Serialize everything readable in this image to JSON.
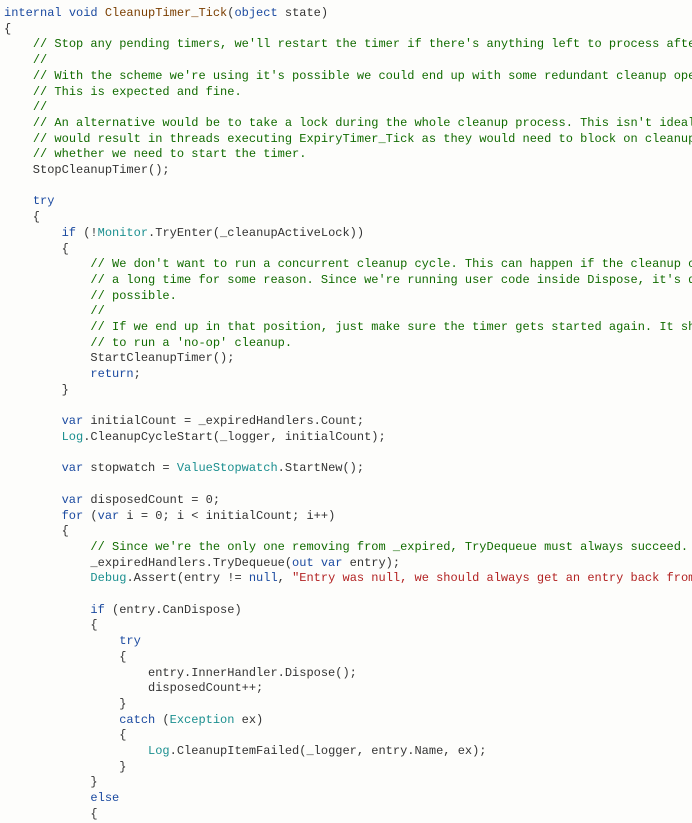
{
  "tokens": [
    {
      "c": "kw",
      "t": "internal"
    },
    {
      "t": " "
    },
    {
      "c": "kw",
      "t": "void"
    },
    {
      "t": " "
    },
    {
      "c": "method",
      "t": "CleanupTimer_Tick"
    },
    {
      "t": "("
    },
    {
      "c": "kw",
      "t": "object"
    },
    {
      "t": " state)\n"
    },
    {
      "t": "{\n"
    },
    {
      "t": "    "
    },
    {
      "c": "cmt",
      "t": "// Stop any pending timers, we'll restart the timer if there's anything left to process after cleanup"
    },
    {
      "t": "\n"
    },
    {
      "t": "    "
    },
    {
      "c": "cmt",
      "t": "//"
    },
    {
      "t": "\n"
    },
    {
      "t": "    "
    },
    {
      "c": "cmt",
      "t": "// With the scheme we're using it's possible we could end up with some redundant cleanup operations."
    },
    {
      "t": "\n"
    },
    {
      "t": "    "
    },
    {
      "c": "cmt",
      "t": "// This is expected and fine."
    },
    {
      "t": "\n"
    },
    {
      "t": "    "
    },
    {
      "c": "cmt",
      "t": "//"
    },
    {
      "t": "\n"
    },
    {
      "t": "    "
    },
    {
      "c": "cmt",
      "t": "// An alternative would be to take a lock during the whole cleanup process. This isn't ideal because it"
    },
    {
      "t": "\n"
    },
    {
      "t": "    "
    },
    {
      "c": "cmt",
      "t": "// would result in threads executing ExpiryTimer_Tick as they would need to block on cleanup to figure out"
    },
    {
      "t": "\n"
    },
    {
      "t": "    "
    },
    {
      "c": "cmt",
      "t": "// whether we need to start the timer."
    },
    {
      "t": "\n"
    },
    {
      "t": "    StopCleanupTimer();\n"
    },
    {
      "t": "\n"
    },
    {
      "t": "    "
    },
    {
      "c": "kw",
      "t": "try"
    },
    {
      "t": "\n"
    },
    {
      "t": "    {\n"
    },
    {
      "t": "        "
    },
    {
      "c": "kw",
      "t": "if"
    },
    {
      "t": " (!"
    },
    {
      "c": "type",
      "t": "Monitor"
    },
    {
      "t": ".TryEnter(_cleanupActiveLock))\n"
    },
    {
      "t": "        {\n"
    },
    {
      "t": "            "
    },
    {
      "c": "cmt",
      "t": "// We don't want to run a concurrent cleanup cycle. This can happen if the cleanup cycle takes"
    },
    {
      "t": "\n"
    },
    {
      "t": "            "
    },
    {
      "c": "cmt",
      "t": "// a long time for some reason. Since we're running user code inside Dispose, it's definitely"
    },
    {
      "t": "\n"
    },
    {
      "t": "            "
    },
    {
      "c": "cmt",
      "t": "// possible."
    },
    {
      "t": "\n"
    },
    {
      "t": "            "
    },
    {
      "c": "cmt",
      "t": "//"
    },
    {
      "t": "\n"
    },
    {
      "t": "            "
    },
    {
      "c": "cmt",
      "t": "// If we end up in that position, just make sure the timer gets started again. It should be cheap"
    },
    {
      "t": "\n"
    },
    {
      "t": "            "
    },
    {
      "c": "cmt",
      "t": "// to run a 'no-op' cleanup."
    },
    {
      "t": "\n"
    },
    {
      "t": "            StartCleanupTimer();\n"
    },
    {
      "t": "            "
    },
    {
      "c": "kw",
      "t": "return"
    },
    {
      "t": ";\n"
    },
    {
      "t": "        }\n"
    },
    {
      "t": "\n"
    },
    {
      "t": "        "
    },
    {
      "c": "kw",
      "t": "var"
    },
    {
      "t": " initialCount = _expiredHandlers.Count;\n"
    },
    {
      "t": "        "
    },
    {
      "c": "type",
      "t": "Log"
    },
    {
      "t": ".CleanupCycleStart(_logger, initialCount);\n"
    },
    {
      "t": "\n"
    },
    {
      "t": "        "
    },
    {
      "c": "kw",
      "t": "var"
    },
    {
      "t": " stopwatch = "
    },
    {
      "c": "type",
      "t": "ValueStopwatch"
    },
    {
      "t": ".StartNew();\n"
    },
    {
      "t": "\n"
    },
    {
      "t": "        "
    },
    {
      "c": "kw",
      "t": "var"
    },
    {
      "t": " disposedCount = 0;\n"
    },
    {
      "t": "        "
    },
    {
      "c": "kw",
      "t": "for"
    },
    {
      "t": " ("
    },
    {
      "c": "kw",
      "t": "var"
    },
    {
      "t": " i = 0; i < initialCount; i++)\n"
    },
    {
      "t": "        {\n"
    },
    {
      "t": "            "
    },
    {
      "c": "cmt",
      "t": "// Since we're the only one removing from _expired, TryDequeue must always succeed."
    },
    {
      "t": "\n"
    },
    {
      "t": "            _expiredHandlers.TryDequeue("
    },
    {
      "c": "kw",
      "t": "out"
    },
    {
      "t": " "
    },
    {
      "c": "kw",
      "t": "var"
    },
    {
      "t": " entry);\n"
    },
    {
      "t": "            "
    },
    {
      "c": "type",
      "t": "Debug"
    },
    {
      "t": ".Assert(entry != "
    },
    {
      "c": "kw",
      "t": "null"
    },
    {
      "t": ", "
    },
    {
      "c": "str",
      "t": "\"Entry was null, we should always get an entry back from TryDeque\""
    },
    {
      "t": "\n"
    },
    {
      "t": "\n"
    },
    {
      "t": "            "
    },
    {
      "c": "kw",
      "t": "if"
    },
    {
      "t": " (entry.CanDispose)\n"
    },
    {
      "t": "            {\n"
    },
    {
      "t": "                "
    },
    {
      "c": "kw",
      "t": "try"
    },
    {
      "t": "\n"
    },
    {
      "t": "                {\n"
    },
    {
      "t": "                    entry.InnerHandler.Dispose();\n"
    },
    {
      "t": "                    disposedCount++;\n"
    },
    {
      "t": "                }\n"
    },
    {
      "t": "                "
    },
    {
      "c": "kw",
      "t": "catch"
    },
    {
      "t": " ("
    },
    {
      "c": "type",
      "t": "Exception"
    },
    {
      "t": " ex)\n"
    },
    {
      "t": "                {\n"
    },
    {
      "t": "                    "
    },
    {
      "c": "type",
      "t": "Log"
    },
    {
      "t": ".CleanupItemFailed(_logger, entry.Name, ex);\n"
    },
    {
      "t": "                }\n"
    },
    {
      "t": "            }\n"
    },
    {
      "t": "            "
    },
    {
      "c": "kw",
      "t": "else"
    },
    {
      "t": "\n"
    },
    {
      "t": "            {\n"
    }
  ]
}
